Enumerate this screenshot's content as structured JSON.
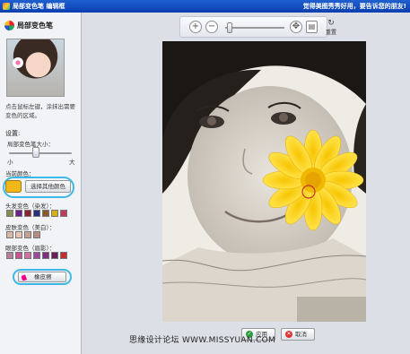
{
  "titlebar": {
    "title": "局部变色笔 编辑框",
    "slogan": "觉得美图秀秀好用，要告诉您的朋友!"
  },
  "panel": {
    "title": "局部变色笔",
    "instructions": "点击鼠标左键，涂抹出需要变色的区域。",
    "settings_title": "设置:",
    "brush_size_label": "局部变色笔大小：",
    "slider_min": "小",
    "slider_max": "大",
    "current_color_label": "当前颜色：",
    "current_color": "#f2b81a",
    "other_color_button": "选择其他颜色",
    "hair_label": "头发变色（染发）：",
    "hair_colors": [
      "#8a8a55",
      "#6a1f8e",
      "#8a2230",
      "#2a2f7a",
      "#8a5a2c",
      "#d7b016",
      "#c03a5a"
    ],
    "skin_label": "皮肤变色（美白）：",
    "skin_colors": [
      "#d9b8a3",
      "#e6c3b5",
      "#c7a08e",
      "#b58e83"
    ],
    "eyeshadow_label": "眼部变色（眉影）：",
    "eyeshadow_colors": [
      "#b97fa0",
      "#c2568a",
      "#d070a3",
      "#9a4a9a",
      "#7f2d7f",
      "#6a1e5a",
      "#c03030"
    ],
    "eraser_button": "橡皮擦"
  },
  "toolbar": {
    "zoom_in_icon": "zoom-in-icon",
    "zoom_out_icon": "zoom-out-icon",
    "reset_label": "重置"
  },
  "actions": {
    "ok_label": "应用",
    "cancel_label": "取消"
  },
  "watermark": "思缘设计论坛 WWW.MISSYUAN.COM"
}
